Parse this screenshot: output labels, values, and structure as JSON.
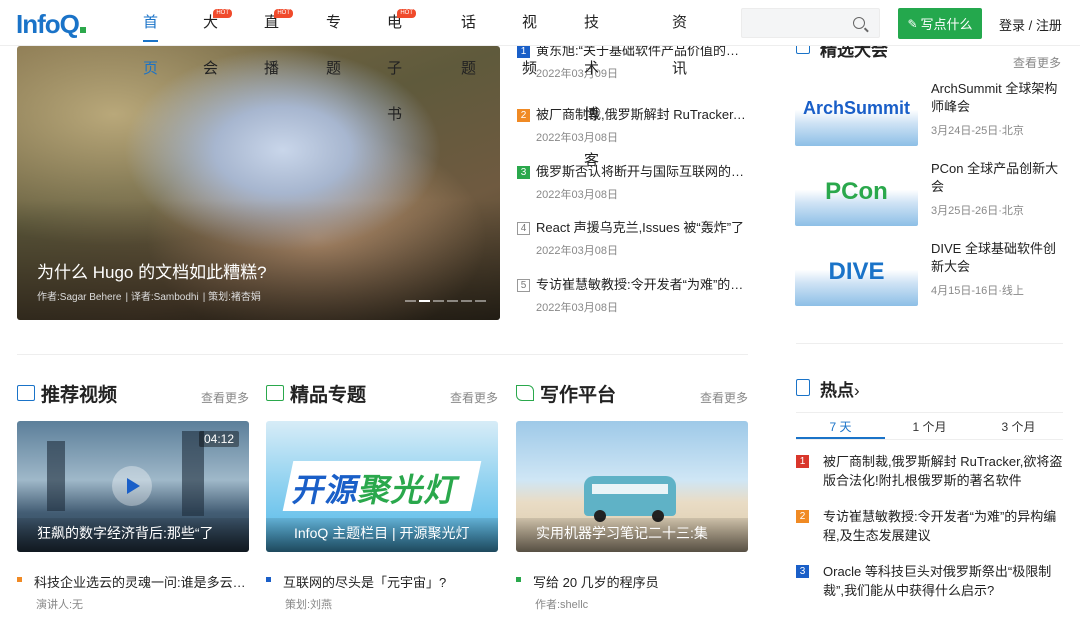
{
  "header": {
    "logo": "InfoQ",
    "nav": [
      {
        "label": "首页",
        "active": true,
        "hot": false
      },
      {
        "label": "大会",
        "active": false,
        "hot": true
      },
      {
        "label": "直播",
        "active": false,
        "hot": true
      },
      {
        "label": "专题",
        "active": false,
        "hot": false
      },
      {
        "label": "电子书",
        "active": false,
        "hot": true
      },
      {
        "label": "话题",
        "active": false,
        "hot": false
      },
      {
        "label": "视频",
        "active": false,
        "hot": false
      },
      {
        "label": "技术博客",
        "active": false,
        "hot": false
      },
      {
        "label": "资讯",
        "active": false,
        "hot": false
      }
    ],
    "hot_label": "HOT",
    "search_placeholder": "",
    "write_label": "写点什么",
    "login_label": "登录 / 注册"
  },
  "hero": {
    "title": "为什么 Hugo 的文档如此糟糕?",
    "author": "作者:Sagar Behere",
    "translator": "译者:Sambodhi",
    "planner": "策划:褚杏娟",
    "slide_count": 6,
    "active_slide": 2
  },
  "news": [
    {
      "rank": "1",
      "title": "黄东旭:“关于基础软件产品价值的思考”",
      "date": "2022年03月09日"
    },
    {
      "rank": "2",
      "title": "被厂商制裁,俄罗斯解封 RuTracker,欲将盗版合法化!",
      "date": "2022年03月08日"
    },
    {
      "rank": "3",
      "title": "俄罗斯否认将断开与国际互联网的连接",
      "date": "2022年03月08日"
    },
    {
      "rank": "4",
      "title": "React 声援乌克兰,Issues 被“轰炸”了",
      "date": "2022年03月08日"
    },
    {
      "rank": "5",
      "title": "专访崔慧敏教授:令开发者“为难”的异构编程",
      "date": "2022年03月08日"
    }
  ],
  "events": {
    "heading": "精选大会",
    "more": "查看更多",
    "items": [
      {
        "logo": "ArchSummit",
        "title": "ArchSummit 全球架构师峰会",
        "date": "3月24日-25日·北京",
        "color": "#1a5fc8"
      },
      {
        "logo": "PCon",
        "title": "PCon 全球产品创新大会",
        "date": "3月25日-26日·北京",
        "color": "#2aa84c"
      },
      {
        "logo": "DIVE",
        "title": "DIVE 全球基础软件创新大会",
        "date": "4月15日-16日·线上",
        "color": "#1a73c8"
      }
    ]
  },
  "sections": [
    {
      "title": "推荐视频",
      "more": "查看更多",
      "caption": "狂飙的数字经济背后:那些“了",
      "duration": "04:12",
      "item": {
        "title": "科技企业选云的灵魂一问:谁是多云时代的最优选?",
        "sub": "演讲人:无"
      }
    },
    {
      "title": "精品专题",
      "more": "查看更多",
      "caption": "InfoQ 主题栏目 | 开源聚光灯",
      "banner": "开源聚光灯",
      "item": {
        "title": "互联网的尽头是「元宇宙」?",
        "sub": "策划:刘燕"
      }
    },
    {
      "title": "写作平台",
      "more": "查看更多",
      "caption": "实用机器学习笔记二十三:集",
      "item": {
        "title": "写给 20 几岁的程序员",
        "sub": "作者:shellc"
      }
    }
  ],
  "hot": {
    "title": "热点",
    "tabs": [
      {
        "label": "7 天",
        "active": true
      },
      {
        "label": "1 个月",
        "active": false
      },
      {
        "label": "3 个月",
        "active": false
      }
    ],
    "items": [
      {
        "rank": "1",
        "title": "被厂商制裁,俄罗斯解封 RuTracker,欲将盗版合法化!附扎根俄罗斯的著名软件"
      },
      {
        "rank": "2",
        "title": "专访崔慧敏教授:令开发者“为难”的异构编程,及生态发展建议"
      },
      {
        "rank": "3",
        "title": "Oracle 等科技巨头对俄罗斯祭出“极限制裁”,我们能从中获得什么启示?"
      }
    ]
  }
}
